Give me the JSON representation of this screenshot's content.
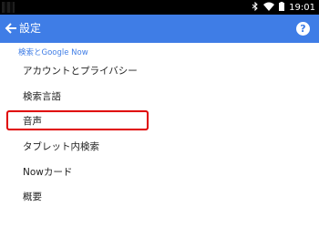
{
  "status_bar": {
    "time": "19:01",
    "icons": [
      "bluetooth-icon",
      "wifi-icon",
      "battery-icon"
    ]
  },
  "app_bar": {
    "title": "設定",
    "back_icon": "arrow-left-icon",
    "help_icon": "?"
  },
  "section": {
    "header": "検索とGoogle Now"
  },
  "items": [
    {
      "label": "アカウントとプライバシー"
    },
    {
      "label": "検索言語"
    },
    {
      "label": "音声"
    },
    {
      "label": "タブレット内検索"
    },
    {
      "label": "Nowカード"
    },
    {
      "label": "概要"
    }
  ],
  "colors": {
    "accent": "#3f7de6",
    "highlight": "#e00000"
  }
}
